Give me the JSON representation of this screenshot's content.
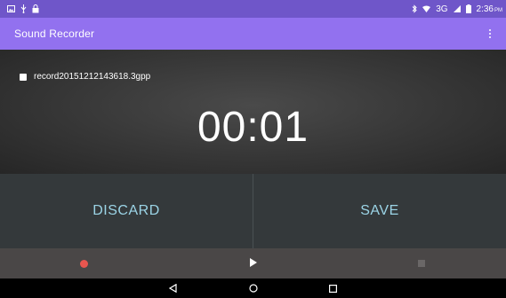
{
  "status_bar": {
    "time": "2:36",
    "ampm": "PM",
    "network": "3G",
    "icons": [
      "image-icon",
      "usb-icon",
      "lock-icon",
      "bluetooth-icon",
      "wifi-icon",
      "signal-icon",
      "battery-icon"
    ]
  },
  "app_bar": {
    "title": "Sound Recorder",
    "overflow_icon": "more-vert-icon"
  },
  "recording": {
    "file_name": "record20151212143618.3gpp",
    "elapsed": "00:01"
  },
  "actions": {
    "discard_label": "DISCARD",
    "save_label": "SAVE"
  },
  "controls": {
    "record_color": "#e8564f",
    "icons": [
      "record-icon",
      "play-icon",
      "stop-icon"
    ]
  },
  "nav": {
    "icons": [
      "back-icon",
      "home-icon",
      "recents-icon"
    ]
  },
  "colors": {
    "status_bar": "#6f56c9",
    "app_bar": "#9271ef",
    "action_text": "#9bd4e6"
  }
}
